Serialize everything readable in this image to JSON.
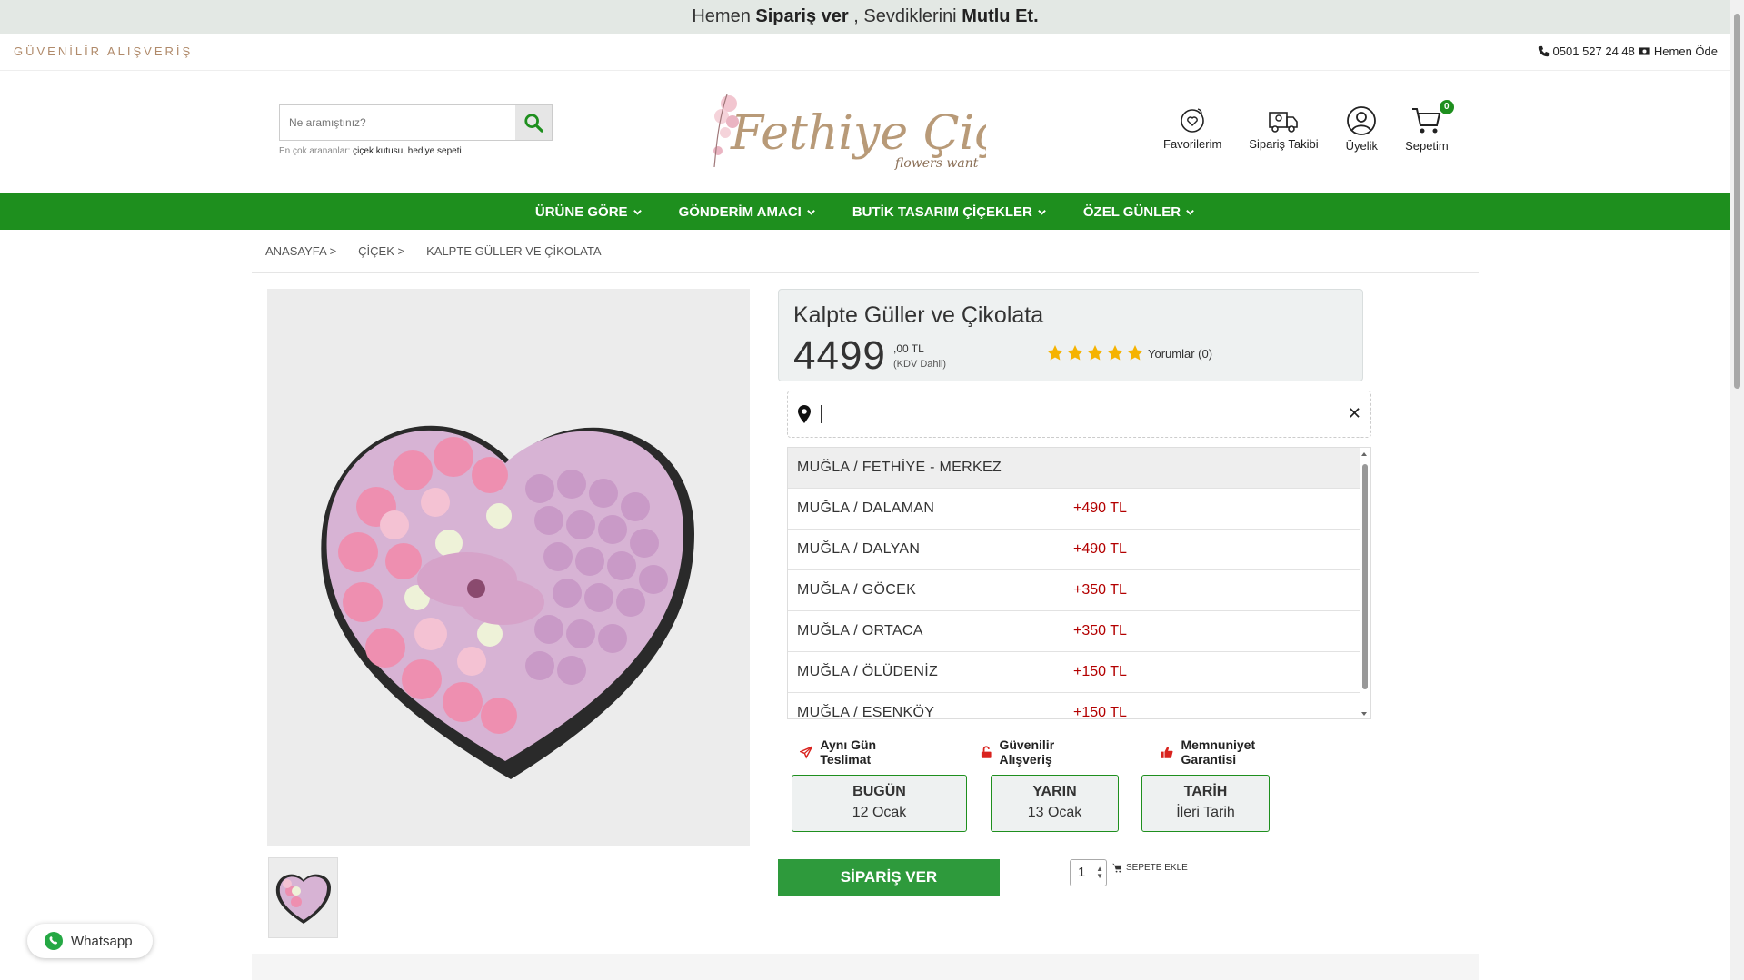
{
  "promo": {
    "pre": "Hemen",
    "bold1": "Sipariş ver",
    "mid": ", Sevdiklerini",
    "bold2": "Mutlu Et."
  },
  "util": {
    "trust": "GÜVENİLİR ALIŞVERİŞ",
    "phone": "0501 527 24 48",
    "pay_now": "Hemen Öde"
  },
  "search": {
    "placeholder": "Ne aramıştınız?",
    "popular_prefix": "En çok arananlar:",
    "popular_1": "çiçek kutusu",
    "popular_2": "hediye sepeti"
  },
  "logo": {
    "line1": "Fethiye Çiçek",
    "line2": "flowers want"
  },
  "header_links": {
    "favorites": "Favorilerim",
    "order_tracking": "Sipariş Takibi",
    "membership": "Üyelik",
    "cart": "Sepetim",
    "cart_count": "0"
  },
  "nav": [
    {
      "label": "ÜRÜNE GÖRE"
    },
    {
      "label": "GÖNDERİM AMACI"
    },
    {
      "label": "BUTİK TASARIM ÇİÇEKLER"
    },
    {
      "label": "ÖZEL GÜNLER"
    }
  ],
  "breadcrumb": [
    "ANASAYFA >",
    "ÇİÇEK >",
    "KALPTE GÜLLER VE ÇİKOLATA"
  ],
  "product": {
    "title": "Kalpte Güller ve Çikolata",
    "price_main": "4499",
    "price_cents": ",00 TL",
    "price_note": "(KDV Dahil)",
    "rating_stars": 5,
    "reviews": "Yorumlar (0)"
  },
  "location": {
    "value": "",
    "clear": "✕"
  },
  "districts": [
    {
      "name": "MUĞLA / FETHİYE - MERKEZ",
      "fee": ""
    },
    {
      "name": "MUĞLA / DALAMAN",
      "fee": "+490 TL"
    },
    {
      "name": "MUĞLA / DALYAN",
      "fee": "+490 TL"
    },
    {
      "name": "MUĞLA / GÖCEK",
      "fee": "+350 TL"
    },
    {
      "name": "MUĞLA / ORTACA",
      "fee": "+350 TL"
    },
    {
      "name": "MUĞLA / ÖLÜDENİZ",
      "fee": "+150 TL"
    },
    {
      "name": "MUĞLA / ESENKÖY",
      "fee": "+150 TL"
    }
  ],
  "features": {
    "same_day": "Aynı Gün Teslimat",
    "secure": "Güvenilir Alışveriş",
    "satisfaction": "Memnuniyet Garantisi"
  },
  "delivery_days": [
    {
      "title": "BUGÜN",
      "date": "12 Ocak"
    },
    {
      "title": "YARIN",
      "date": "13 Ocak"
    },
    {
      "title": "TARİH",
      "date": "İleri Tarih"
    }
  ],
  "actions": {
    "order": "SİPARİŞ VER",
    "quantity": "1",
    "add_to_cart": "SEPETE EKLE"
  },
  "whatsapp": {
    "label": "Whatsapp"
  },
  "colors": {
    "brand_green": "#1e8f1e",
    "order_green": "#2e9a3c",
    "fee_red": "#b30000",
    "star_gold": "#f5b301"
  }
}
